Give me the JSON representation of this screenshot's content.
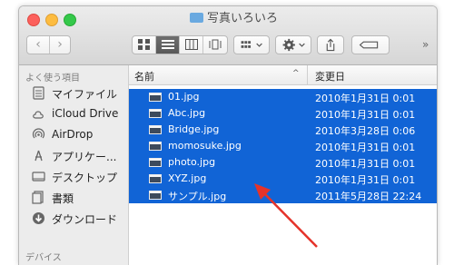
{
  "window": {
    "title": "写真いろいろ"
  },
  "toolbar": {
    "back_icon": "chevron-left-icon",
    "forward_icon": "chevron-right-icon",
    "view_modes": [
      "icon-view",
      "list-view",
      "column-view",
      "cover-flow-view"
    ],
    "selected_view": "list-view",
    "more_label": "»"
  },
  "sidebar": {
    "header": "よく使う項目",
    "items": [
      {
        "label": "マイファイル",
        "icon": "all-my-files-icon"
      },
      {
        "label": "iCloud Drive",
        "icon": "cloud-icon"
      },
      {
        "label": "AirDrop",
        "icon": "airdrop-icon"
      },
      {
        "label": "アプリケー...",
        "icon": "applications-icon"
      },
      {
        "label": "デスクトップ",
        "icon": "desktop-icon"
      },
      {
        "label": "書類",
        "icon": "documents-icon"
      },
      {
        "label": "ダウンロード",
        "icon": "downloads-icon"
      }
    ],
    "next_header": "デバイス"
  },
  "list": {
    "columns": {
      "name": "名前",
      "date": "変更日"
    },
    "sort_indicator": "^",
    "rows": [
      {
        "name": "01.jpg",
        "date": "2010年1月31日 0:01",
        "selected": true
      },
      {
        "name": "Abc.jpg",
        "date": "2010年1月31日 0:01",
        "selected": true
      },
      {
        "name": "Bridge.jpg",
        "date": "2010年3月28日 0:06",
        "selected": true
      },
      {
        "name": "momosuke.jpg",
        "date": "2010年1月31日 0:01",
        "selected": true
      },
      {
        "name": "photo.jpg",
        "date": "2010年1月31日 0:01",
        "selected": true
      },
      {
        "name": "XYZ.jpg",
        "date": "2010年1月31日 0:01",
        "selected": true
      },
      {
        "name": "サンプル.jpg",
        "date": "2011年5月28日 22:24",
        "selected": true
      }
    ]
  },
  "colors": {
    "selection": "#1164d6",
    "annotation_arrow": "#e5332a"
  }
}
